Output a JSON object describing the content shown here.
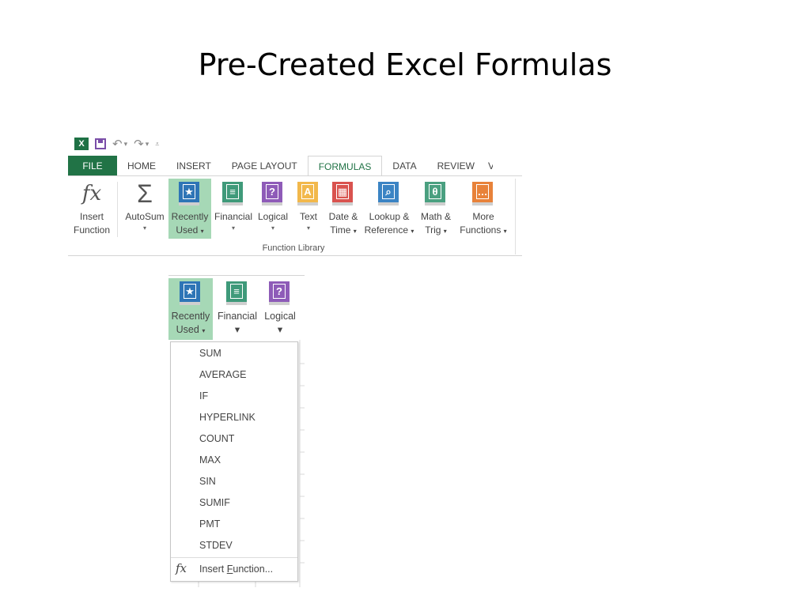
{
  "slide": {
    "title": "Pre-Created Excel Formulas"
  },
  "qat": {
    "logo": "X",
    "undo_icon": "undo-icon",
    "redo_icon": "redo-icon"
  },
  "tabs": [
    {
      "label": "FILE"
    },
    {
      "label": "HOME"
    },
    {
      "label": "INSERT"
    },
    {
      "label": "PAGE LAYOUT"
    },
    {
      "label": "FORMULAS"
    },
    {
      "label": "DATA"
    },
    {
      "label": "REVIEW"
    },
    {
      "label": "V"
    }
  ],
  "ribbon": {
    "insert_function": {
      "line1": "Insert",
      "line2": "Function"
    },
    "autosum": {
      "line1": "AutoSum"
    },
    "recently_used": {
      "line1": "Recently",
      "line2": "Used"
    },
    "financial": {
      "line1": "Financial"
    },
    "logical": {
      "line1": "Logical"
    },
    "text": {
      "line1": "Text"
    },
    "date_time": {
      "line1": "Date &",
      "line2": "Time"
    },
    "lookup": {
      "line1": "Lookup &",
      "line2": "Reference"
    },
    "math": {
      "line1": "Math &",
      "line2": "Trig"
    },
    "more": {
      "line1": "More",
      "line2": "Functions"
    },
    "group_label": "Function Library"
  },
  "panel": {
    "recently_used": {
      "line1": "Recently",
      "line2": "Used"
    },
    "financial": {
      "line1": "Financial"
    },
    "logical": {
      "line1": "Logical"
    }
  },
  "menu": {
    "items": [
      "SUM",
      "AVERAGE",
      "IF",
      "HYPERLINK",
      "COUNT",
      "MAX",
      "SIN",
      "SUMIF",
      "PMT",
      "STDEV"
    ],
    "insert_function": {
      "pre": "Insert ",
      "underlined": "F",
      "post": "unction..."
    }
  },
  "colors": {
    "file_tab": "#217346",
    "selected": "#a6d8b6",
    "book_recent": "#2e75b6",
    "book_financial": "#3f9a7a",
    "book_logical": "#8e5bb8",
    "book_text": "#f2b84b",
    "book_date": "#d9534f",
    "book_lookup": "#3b84c4",
    "book_math": "#4aa080",
    "book_more": "#e8823a"
  }
}
